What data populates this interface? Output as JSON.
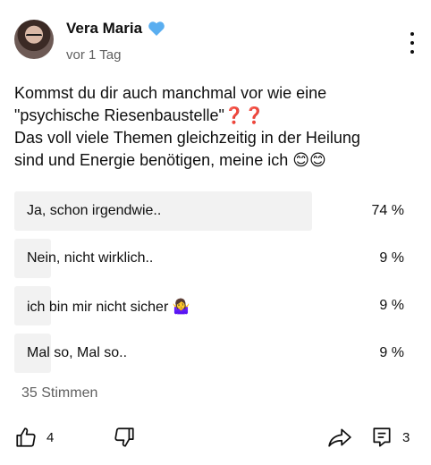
{
  "post": {
    "author": "Vera Maria",
    "author_badge_icon": "blue-heart-icon",
    "time": "vor 1 Tag",
    "text": "Kommst du dir auch manchmal vor wie eine\n\"psychische Riesenbaustelle\"❓❓\nDas voll viele Themen gleichzeitig in der Heilung\nsind und Energie benötigen, meine ich 😊😊"
  },
  "poll": {
    "options": [
      {
        "label": "Ja, schon irgendwie..",
        "percent": "74 %",
        "fraction": 0.74
      },
      {
        "label": "Nein, nicht wirklich..",
        "percent": "9 %",
        "fraction": 0.09
      },
      {
        "label": "ich bin mir nicht sicher 🤷‍♀️",
        "percent": "9 %",
        "fraction": 0.09
      },
      {
        "label": "Mal so, Mal so..",
        "percent": "9 %",
        "fraction": 0.09
      }
    ],
    "votes": "35 Stimmen"
  },
  "actions": {
    "likes": "4",
    "comments": "3"
  },
  "colors": {
    "poll_fill": "#f2f2f2",
    "secondary_text": "#606060",
    "heart": "#5aaef0"
  }
}
